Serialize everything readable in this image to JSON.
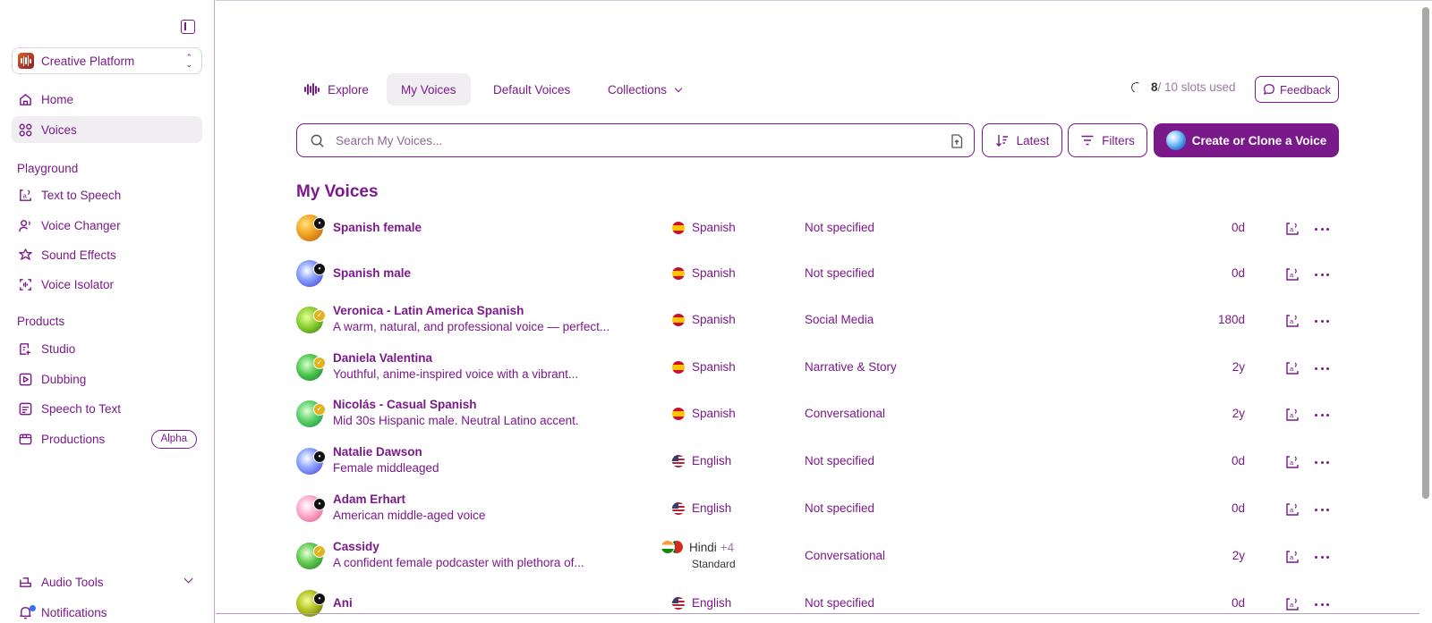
{
  "workspace": {
    "name": "Creative Platform"
  },
  "sidebar": {
    "top": [
      {
        "label": "Home",
        "icon": "home-icon",
        "active": false
      },
      {
        "label": "Voices",
        "icon": "voices-icon",
        "active": true
      }
    ],
    "playground": {
      "title": "Playground",
      "items": [
        {
          "label": "Text to Speech",
          "icon": "text-to-speech-icon"
        },
        {
          "label": "Voice Changer",
          "icon": "voice-changer-icon"
        },
        {
          "label": "Sound Effects",
          "icon": "sound-effects-icon"
        },
        {
          "label": "Voice Isolator",
          "icon": "voice-isolator-icon"
        }
      ]
    },
    "products": {
      "title": "Products",
      "items": [
        {
          "label": "Studio",
          "icon": "studio-icon"
        },
        {
          "label": "Dubbing",
          "icon": "dubbing-icon"
        },
        {
          "label": "Speech to Text",
          "icon": "speech-to-text-icon"
        },
        {
          "label": "Productions",
          "icon": "productions-icon",
          "badge": "Alpha"
        }
      ]
    },
    "bottom": [
      {
        "label": "Audio Tools",
        "icon": "audio-tools-icon"
      },
      {
        "label": "Notifications",
        "icon": "bell-icon"
      }
    ]
  },
  "tabs": [
    {
      "label": "Explore",
      "icon": "waveform-icon",
      "active": false
    },
    {
      "label": "My Voices",
      "active": true
    },
    {
      "label": "Default Voices",
      "active": false
    },
    {
      "label": "Collections",
      "active": false
    }
  ],
  "slots": {
    "used": "8",
    "rest": "/ 10 slots used"
  },
  "feedback_label": "Feedback",
  "search": {
    "placeholder": "Search My Voices..."
  },
  "sort_label": "Latest",
  "filters_label": "Filters",
  "create_label": "Create or Clone a Voice",
  "section_title": "My Voices",
  "voices": [
    {
      "name": "Spanish female",
      "desc": "",
      "language": "Spanish",
      "flag": "es",
      "category": "Not specified",
      "age": "0d",
      "badge": "dark",
      "avatar": "radial-gradient(circle at 35% 35%, #ffe07a, #f0a020 45%, #b05a10 100%)"
    },
    {
      "name": "Spanish male",
      "desc": "",
      "language": "Spanish",
      "flag": "es",
      "category": "Not specified",
      "age": "0d",
      "badge": "dark",
      "avatar": "radial-gradient(circle at 40% 40%, #ffffff, #8aa0ff 40%, #3a3ad0 100%)"
    },
    {
      "name": "Veronica - Latin America Spanish",
      "desc": "A warm, natural, and professional voice — perfect...",
      "language": "Spanish",
      "flag": "es",
      "category": "Social Media",
      "age": "180d",
      "badge": "gold",
      "avatar": "radial-gradient(circle at 40% 40%, #e8ff9a, #8ad030 45%, #2a7a10 100%)"
    },
    {
      "name": "Daniela Valentina",
      "desc": "Youthful, anime-inspired voice with a vibrant...",
      "language": "Spanish",
      "flag": "es",
      "category": "Narrative & Story",
      "age": "2y",
      "badge": "gold",
      "avatar": "radial-gradient(circle at 40% 40%, #d8ffd0, #50c850 45%, #0a7a2a 100%)"
    },
    {
      "name": "Nicolás - Casual Spanish",
      "desc": "Mid 30s Hispanic male. Neutral Latino accent.",
      "language": "Spanish",
      "flag": "es",
      "category": "Conversational",
      "age": "2y",
      "badge": "gold",
      "avatar": "radial-gradient(circle at 40% 40%, #e0ffd8, #58d068 45%, #108a3a 100%)"
    },
    {
      "name": "Natalie Dawson",
      "desc": "Female middleaged",
      "language": "English",
      "flag": "us",
      "category": "Not specified",
      "age": "0d",
      "badge": "dark",
      "avatar": "radial-gradient(circle at 40% 40%, #ffffff, #90a8ff 40%, #4a3ad8 100%)"
    },
    {
      "name": "Adam Erhart",
      "desc": "American middle-aged voice",
      "language": "English",
      "flag": "us",
      "category": "Not specified",
      "age": "0d",
      "badge": "dark",
      "avatar": "radial-gradient(circle at 40% 40%, #ffffff, #ffb0d0 40%, #e0508a 100%)"
    },
    {
      "name": "Cassidy",
      "desc": "A confident female podcaster with plethora of...",
      "language": "Hindi",
      "flag": "multi",
      "extra": "+4",
      "sub": "Standard",
      "category": "Conversational",
      "age": "2y",
      "badge": "gold",
      "avatar": "radial-gradient(circle at 40% 40%, #e8ffd8, #60c850 45%, #1a7a20 100%)"
    },
    {
      "name": "Ani",
      "desc": "",
      "language": "English",
      "flag": "us",
      "category": "Not specified",
      "age": "0d",
      "badge": "dark",
      "avatar": "radial-gradient(circle at 40% 40%, #f0ff9a, #b0c020 45%, #5a6a10 100%)"
    }
  ]
}
